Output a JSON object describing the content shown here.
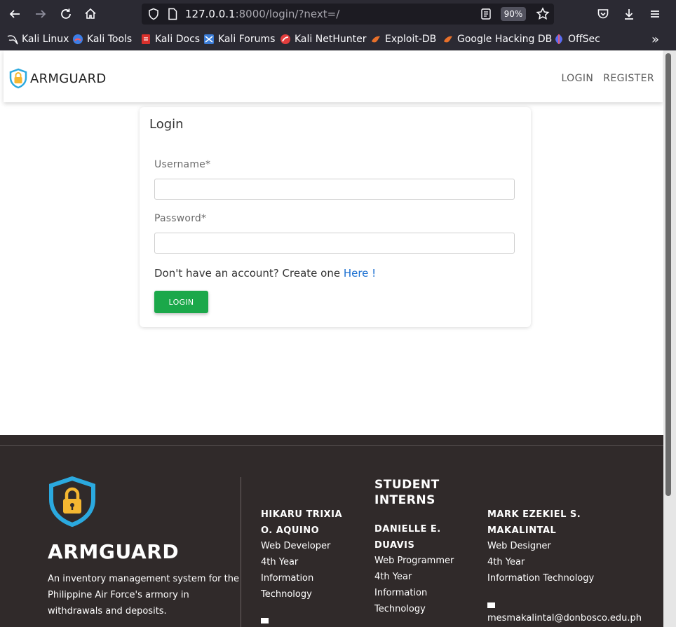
{
  "browser": {
    "url_host": "127.0.0.1",
    "url_rest": ":8000/login/?next=/",
    "zoom": "90%",
    "bookmarks": [
      "Kali Linux",
      "Kali Tools",
      "Kali Docs",
      "Kali Forums",
      "Kali NetHunter",
      "Exploit-DB",
      "Google Hacking DB",
      "OffSec"
    ],
    "overflow": "»"
  },
  "navbar": {
    "brand": "ARMGUARD",
    "login": "LOGIN",
    "register": "REGISTER"
  },
  "login_form": {
    "title": "Login",
    "username_label": "Username*",
    "password_label": "Password*",
    "signup_text": "Don't have an account? Create one ",
    "signup_link": "Here !",
    "submit": "LOGIN"
  },
  "footer": {
    "brand": "ARMGUARD",
    "description": "An inventory management system for the Philippine Air Force's armory in withdrawals and deposits.",
    "heading_line1": "STUDENT",
    "heading_line2": "INTERNS",
    "intern1": {
      "name1": "HIKARU TRIXIA",
      "name2": "O. AQUINO",
      "role": "Web Developer",
      "year": "4th Year",
      "course1": "Information",
      "course2": "Technology"
    },
    "intern2": {
      "name1": "DANIELLE E.",
      "name2": "DUAVIS",
      "role": "Web Programmer",
      "year": "4th Year",
      "course1": "Information",
      "course2": "Technology"
    },
    "intern3": {
      "name1": "MARK EZEKIEL S.",
      "name2": "MAKALINTAL",
      "role": "Web Designer",
      "year": "4th Year",
      "course1": "Information Technology",
      "email": "mesmakalintal@donbosco.edu.ph"
    }
  }
}
